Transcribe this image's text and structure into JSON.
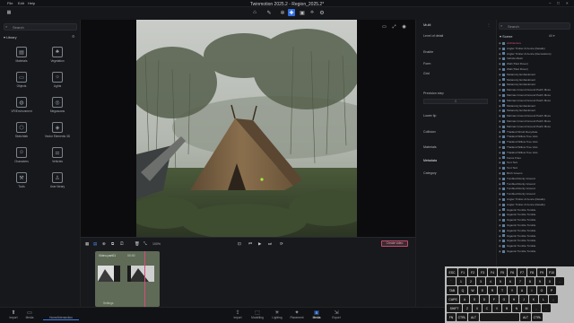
{
  "window": {
    "title": "Twinmotion 2025.2 - Region_2025.2*",
    "menu": [
      "File",
      "Edit",
      "Help"
    ]
  },
  "toolbar": {
    "icons": [
      "home-icon",
      "brush-icon",
      "gear-icon",
      "pointer-icon",
      "image-icon",
      "path-icon",
      "fill-icon",
      "settings-icon"
    ],
    "selected_index": 3
  },
  "library": {
    "title": "Library",
    "search_placeholder": "Search",
    "items": [
      "Materials",
      "Vegetation",
      "Objects",
      "Lights",
      "VR/Environment",
      "Megascans",
      "Sketchfab",
      "Vector Elements 3D",
      "Characters",
      "Vehicles",
      "Tools",
      "User library"
    ]
  },
  "properties": {
    "title": "Multi",
    "items": [
      "Level of detail",
      "Enable",
      "Form",
      "Grid",
      "Precision step",
      "Lower lip",
      "Collision",
      "Materials",
      "Metadata",
      "Category"
    ],
    "input_value": "0"
  },
  "scene": {
    "title": "Scene",
    "search_placeholder": "Search",
    "filter": "All",
    "items": [
      "Architecture",
      "Angler Timber & Fence (Details)",
      "Angler Timber & Fence (Decorations)",
      "Vehicle Mesh",
      "Wall (Tiled Rover)",
      "Wall (Tiled Rover)",
      "Melancoly Embankment",
      "Melancoly Embankment",
      "Melancoly Embankment",
      "Marinas Ground Ground Patch Moss",
      "Marinas Ground Ground Patch Moss",
      "Marinas Ground Ground Patch Moss",
      "Melancoly Embankment",
      "Melancoly Embankment",
      "Marinas Ground Ground Patch Moss",
      "Marinas Ground Ground Patch Moss",
      "Marinas Ground Ground Patch Moss",
      "Thailand Shrub Recyclate",
      "Thailand Willow Tree Vets",
      "Thailand Willow Tree Vets",
      "Thailand Willow Tree Vets",
      "Thailand Willow Tree Vets",
      "Fence Fries",
      "Tent Tent",
      "Tent Tent",
      "Birch Greens",
      "Tumbled Rocky Ground",
      "Tumbled Rocky Ground",
      "Tumbled Rocky Ground",
      "Tumbled Rocky Ground",
      "Angler Timber & Fence (Details)",
      "Angler Timber & Fence (Details)",
      "Gigantic Tumble Tumble",
      "Gigantic Tumble Tumble",
      "Gigantic Tumble Tumble",
      "Gigantic Tumble Tumble",
      "Gigantic Tumble Tumble",
      "Gigantic Tumble Tumble",
      "Gigantic Tumble Tumble",
      "Gigantic Tumble Tumble",
      "Gigantic Tumble Tumble"
    ]
  },
  "timeline": {
    "clip_title": "Video part01",
    "clip_duration": "00:00",
    "zoom": "100%",
    "export_label": "Create video",
    "sub_label": "Settings"
  },
  "bottombar": {
    "left": [
      "Import",
      "Media",
      "Home/Intersection"
    ],
    "center": [
      "Import",
      "Modelling",
      "Lighting",
      "Placement",
      "Media",
      "Export"
    ],
    "selected": "Media"
  },
  "keyboard": {
    "row0": [
      "ESC",
      "F1",
      "F2",
      "F3",
      "F4",
      "F5",
      "F6",
      "F7",
      "F8",
      "F9",
      "F10"
    ],
    "row1": [
      "`",
      "1",
      "2",
      "3",
      "4",
      "5",
      "6",
      "7",
      "8",
      "9",
      "0",
      "-"
    ],
    "row2": [
      "TAB",
      "Q",
      "W",
      "E",
      "R",
      "T",
      "Y",
      "U",
      "I",
      "O",
      "P"
    ],
    "row3": [
      "CAPS",
      "A",
      "S",
      "D",
      "F",
      "G",
      "H",
      "J",
      "K",
      "L",
      ";"
    ],
    "row4": [
      "SHIFT",
      "Z",
      "X",
      "C",
      "V",
      "B",
      "N",
      "M",
      ",",
      "."
    ],
    "row5": [
      "FN",
      "CTRL",
      "ALT",
      "",
      "ALT",
      "CTRL"
    ]
  },
  "colors": {
    "accent": "#2f6fe0",
    "clip": "#5f6a57",
    "export": "#c24a6a"
  }
}
